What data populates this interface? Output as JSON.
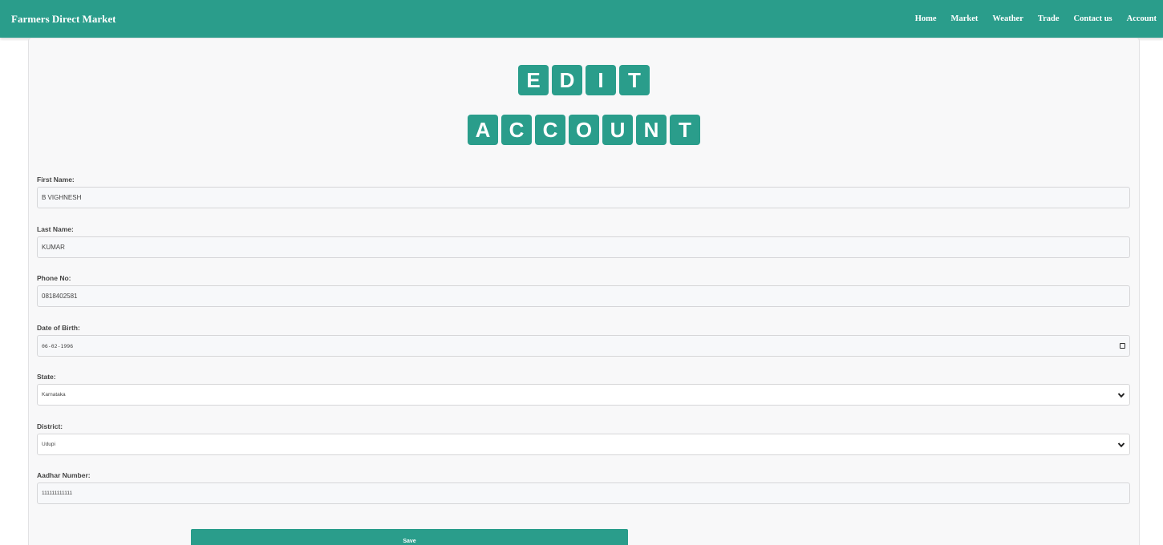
{
  "navbar": {
    "brand": "Farmers Direct Market",
    "links": [
      "Home",
      "Market",
      "Weather",
      "Trade",
      "Contact us",
      "Account"
    ]
  },
  "title": {
    "line1": [
      "E",
      "D",
      "I",
      "T"
    ],
    "line2": [
      "A",
      "C",
      "C",
      "O",
      "U",
      "N",
      "T"
    ]
  },
  "form": {
    "first_name": {
      "label": "First Name:",
      "value": "B VIGHNESH"
    },
    "last_name": {
      "label": "Last Name:",
      "value": "KUMAR"
    },
    "phone": {
      "label": "Phone No:",
      "value": "0818402581"
    },
    "dob": {
      "label": "Date of Birth:",
      "value": "06-02-1996"
    },
    "state": {
      "label": "State:",
      "value": "Karnataka"
    },
    "district": {
      "label": "District:",
      "value": "Udupi"
    },
    "aadhar": {
      "label": "Aadhar Number:",
      "value": "111111111111"
    },
    "save_label": "Save"
  },
  "colors": {
    "accent": "#2a9d8b",
    "card_bg": "#f8f8f9"
  }
}
